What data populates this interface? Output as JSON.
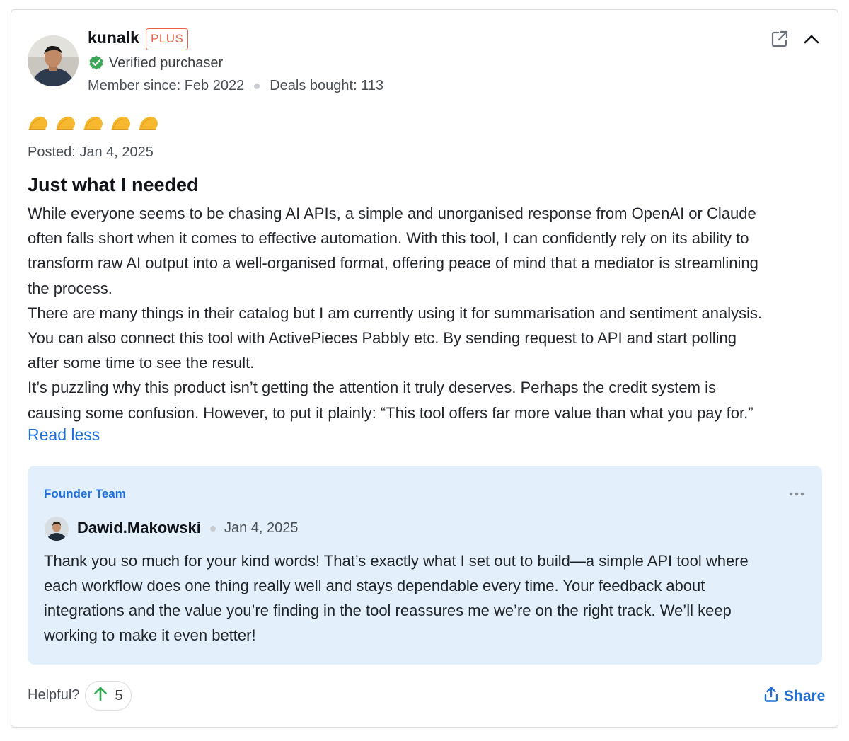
{
  "reviewer": {
    "username": "kunalk",
    "badge": "PLUS",
    "verified_label": "Verified purchaser",
    "member_since": "Member since: Feb 2022",
    "deals_bought": "Deals bought: 113"
  },
  "rating": {
    "value": 5,
    "max": 5
  },
  "posted": "Posted: Jan 4, 2025",
  "review": {
    "title": "Just what I needed",
    "lines": [
      "While everyone seems to be chasing AI APIs, a simple and unorganised response from OpenAI or Claude",
      "often falls short when it comes to effective automation. With this tool, I can confidently rely on its ability to",
      "transform raw AI output into a well-organised format, offering peace of mind that a mediator is streamlining",
      "the process.",
      "There are many things in their catalog but I am currently using it for summarisation and sentiment analysis.",
      "You can also connect this tool with ActivePieces Pabbly etc. By sending request to API and start polling",
      "after some time to see the result.",
      "It’s puzzling why this product isn’t getting the attention it truly deserves. Perhaps the credit system is",
      "causing some confusion. However, to put it plainly: “This tool offers far more value than what you pay for.”"
    ],
    "read_less": "Read less"
  },
  "reply": {
    "team_label": "Founder Team",
    "author": "Dawid.Makowski",
    "date": "Jan 4, 2025",
    "lines": [
      "Thank you so much for your kind words! That’s exactly what I set out to build—a simple API tool where",
      "each workflow does one thing really well and stays dependable every time. Your feedback about",
      "integrations and the value you’re finding in the tool reassures me we’re on the right track. We’ll keep",
      "working to make it even better!"
    ]
  },
  "footer": {
    "helpful_label": "Helpful?",
    "vote_count": "5",
    "share_label": "Share"
  },
  "icons": {
    "external": "external-link-icon",
    "collapse": "chevron-up-icon",
    "verified": "check-circle-icon",
    "star": "taco-star-icon",
    "more": "ellipsis-icon",
    "upvote": "arrow-up-icon",
    "share": "share-upload-icon"
  },
  "colors": {
    "accent_blue": "#1f6fd6",
    "plus_badge": "#e8624a",
    "verified_green": "#3aa856",
    "star_gold": "#f5b82e",
    "reply_bg": "#e3f0fb",
    "upvote_green": "#2fa84f"
  }
}
